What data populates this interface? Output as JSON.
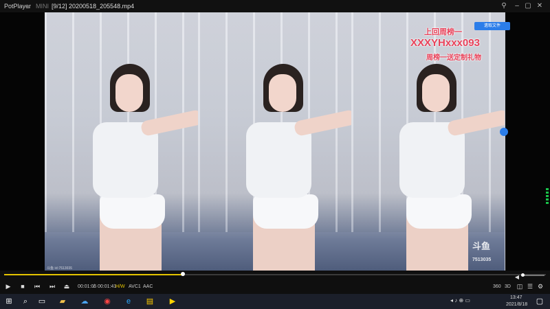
{
  "titlebar": {
    "app_name": "PotPlayer",
    "caret": "⌄",
    "mini_label": "MINI",
    "file_title": "[9/12] 20200518_205548.mp4",
    "pin_icon": "pin-icon",
    "buttons": [
      "–",
      "▢",
      "✕"
    ]
  },
  "video_overlay": {
    "top_right_button": "遗取文件",
    "line1": "上回周榜一",
    "line2": "XXXYHxxx093",
    "line3": "周榜一送定制礼物",
    "watermark_brand": "斗鱼",
    "watermark_sub": "7513035",
    "small_bottom_left": "斗鱼 id:7513035"
  },
  "controls": {
    "current_time": "00:01:05",
    "separator": "/",
    "total_time": "00:01:41",
    "codec_badges": [
      "H/W",
      "AVC1",
      "AAC"
    ],
    "right_labels": [
      "360",
      "3D"
    ]
  },
  "seek": {
    "progress_fraction": 0.33
  },
  "taskbar": {
    "time": "13:47",
    "date": "2021/8/18",
    "tray_text": "◂  ♪  ⊕  ▭"
  },
  "colors": {
    "accent": "#e5c400",
    "blue": "#2b7de9",
    "overlay_text": "#e8425a"
  }
}
